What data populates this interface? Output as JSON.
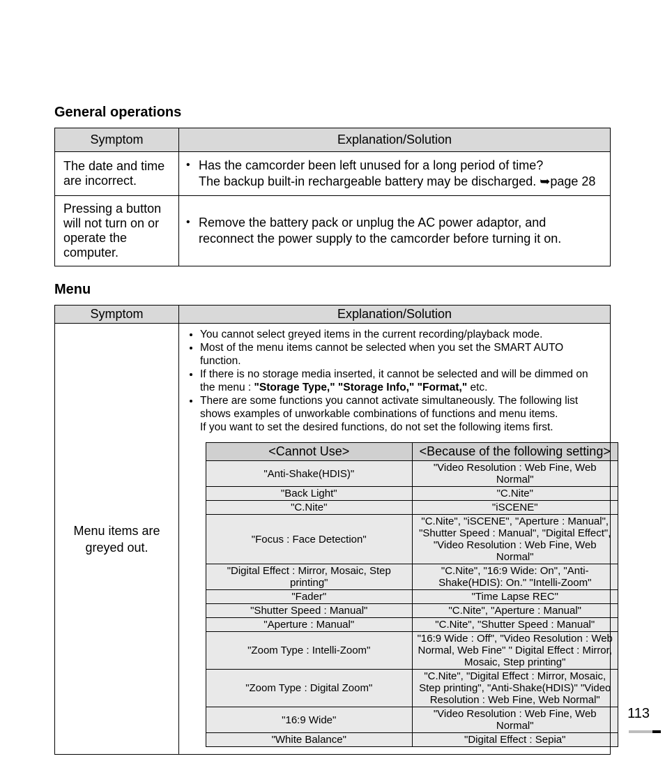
{
  "page_number": "113",
  "sections": {
    "general": {
      "title": "General operations",
      "headers": {
        "symptom": "Symptom",
        "solution": "Explanation/Solution"
      },
      "rows": [
        {
          "symptom": "The date and time are incorrect.",
          "lines": [
            "Has the camcorder been left unused for a long period of time?",
            "The backup built-in rechargeable battery may be discharged. ➥page 28"
          ]
        },
        {
          "symptom": "Pressing a button will not turn on or operate the computer.",
          "lines": [
            "Remove the battery pack or unplug the AC power adaptor, and reconnect the power supply to the camcorder before turning it on."
          ]
        }
      ]
    },
    "menu": {
      "title": "Menu",
      "headers": {
        "symptom": "Symptom",
        "solution": "Explanation/Solution"
      },
      "symptom_text": "Menu items are greyed out.",
      "bullets": [
        {
          "text": "You cannot select greyed items in the current recording/playback mode."
        },
        {
          "text": "Most of the menu items cannot be selected when you set the SMART AUTO function."
        },
        {
          "text_pre": "If there is no storage media inserted, it cannot be selected and will be dimmed on the menu : ",
          "bold": "\"Storage Type,\" \"Storage Info,\" \"Format,\"",
          "text_post": " etc."
        },
        {
          "text": "There are some functions you cannot activate simultaneously. The following list shows examples of unworkable combinations of functions and menu items.",
          "tail": "If you want to set the desired functions, do not set the following items first."
        }
      ],
      "inner_headers": {
        "left": "<Cannot Use>",
        "right": "<Because of the following setting>"
      },
      "inner_rows": [
        {
          "l": "\"Anti-Shake(HDIS)\"",
          "r": "\"Video Resolution : Web Fine, Web Normal\""
        },
        {
          "l": "\"Back Light\"",
          "r": "\"C.Nite\""
        },
        {
          "l": "\"C.Nite\"",
          "r": "\"iSCENE\""
        },
        {
          "l": "\"Focus : Face Detection\"",
          "r": "\"C.Nite\", \"iSCENE\", \"Aperture : Manual\", \"Shutter Speed : Manual\", \"Digital Effect\", \"Video Resolution : Web Fine, Web Normal\""
        },
        {
          "l": "\"Digital Effect : Mirror, Mosaic, Step printing\"",
          "r": "\"C.Nite\", \"16:9 Wide: On\", \"Anti-Shake(HDIS): On.\" \"Intelli-Zoom\""
        },
        {
          "l": "\"Fader\"",
          "r": "\"Time Lapse REC\""
        },
        {
          "l": "\"Shutter Speed : Manual\"",
          "r": "\"C.Nite\", \"Aperture : Manual\""
        },
        {
          "l": "\"Aperture : Manual\"",
          "r": "\"C.Nite\", \"Shutter Speed : Manual\""
        },
        {
          "l": "\"Zoom Type : Intelli-Zoom\"",
          "r": "\"16:9 Wide : Off\",\n\"Video Resolution : Web Normal, Web Fine\" \" Digital Effect : Mirror, Mosaic, Step printing\""
        },
        {
          "l": "\"Zoom Type : Digital Zoom\"",
          "r": "\"C.Nite\", \"Digital Effect : Mirror, Mosaic, Step printing\", \"Anti-Shake(HDIS)\" \"Video Resolution : Web Fine, Web Normal\""
        },
        {
          "l": "\"16:9 Wide\"",
          "r": "\"Video Resolution : Web Fine, Web Normal\""
        },
        {
          "l": "\"White Balance\"",
          "r": "\"Digital Effect : Sepia\""
        }
      ]
    }
  }
}
